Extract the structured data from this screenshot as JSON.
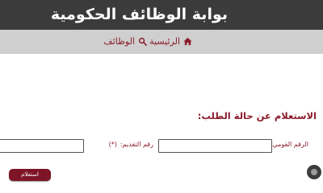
{
  "header": {
    "title": "بوابة الوظائف الحكومية"
  },
  "nav": {
    "home_label": "الرئيسية",
    "home_icon": "home-icon",
    "jobs_label": "الوظائف",
    "jobs_icon": "search-icon"
  },
  "form": {
    "heading": "الاستعلام عن حالة الطلب:",
    "national_id_label": "الرقم القومي:",
    "national_id_required": "(*)",
    "national_id_value": "",
    "application_no_label": "رقم التقديم:",
    "application_no_required": "(*)",
    "application_no_value": "",
    "submit_label": "استعلام"
  },
  "colors": {
    "header_bg": "#3b3b3b",
    "nav_bg": "#cfcfcf",
    "accent": "#8b1c2c",
    "button_bg": "#7e1526"
  }
}
